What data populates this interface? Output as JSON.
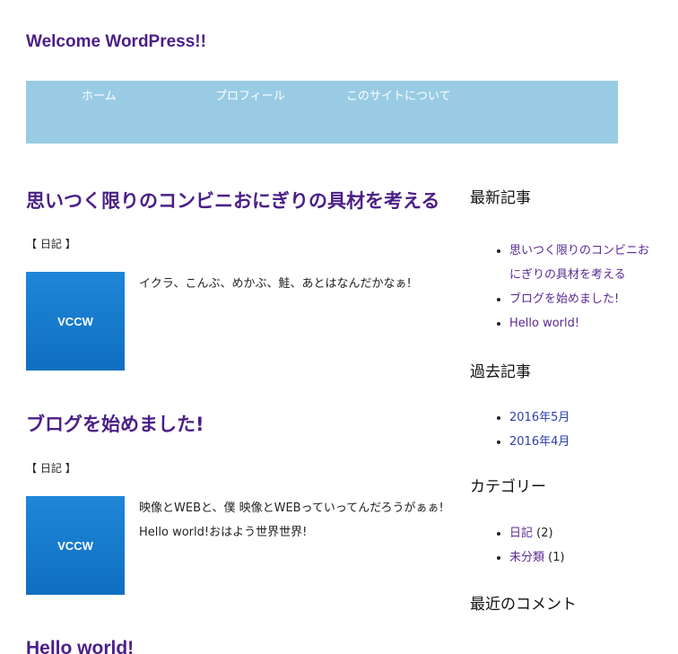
{
  "site": {
    "title": "Welcome WordPress!!"
  },
  "nav": {
    "items": [
      {
        "label": "ホーム"
      },
      {
        "label": "プロフィール"
      },
      {
        "label": "このサイトについて"
      }
    ]
  },
  "posts": [
    {
      "title": "思いつく限りのコンビニおにぎりの具材を考える",
      "category_prefix": "【",
      "category": "日記",
      "category_suffix": "】",
      "thumbnail_label": "VCCW",
      "excerpt": "イクラ、こんぶ、めかぶ、鮭、あとはなんだかなぁ!"
    },
    {
      "title": "ブログを始めました!",
      "category_prefix": "【",
      "category": "日記",
      "category_suffix": "】",
      "thumbnail_label": "VCCW",
      "excerpt": "映像とWEBと、僕 映像とWEBっていってんだろうがぁぁ! Hello world!おはよう世界世界!"
    },
    {
      "title": "Hello world!"
    }
  ],
  "sidebar": {
    "recent_posts": {
      "title": "最新記事",
      "items": [
        {
          "label": "思いつく限りのコンビニおにぎりの具材を考える"
        },
        {
          "label": "ブログを始めました!"
        },
        {
          "label": "Hello world!"
        }
      ]
    },
    "archives": {
      "title": "過去記事",
      "items": [
        {
          "label": "2016年5月"
        },
        {
          "label": "2016年4月"
        }
      ]
    },
    "categories": {
      "title": "カテゴリー",
      "items": [
        {
          "label": "日記",
          "count": "(2)"
        },
        {
          "label": "未分類",
          "count": "(1)"
        }
      ]
    },
    "recent_comments": {
      "title": "最近のコメント"
    }
  }
}
